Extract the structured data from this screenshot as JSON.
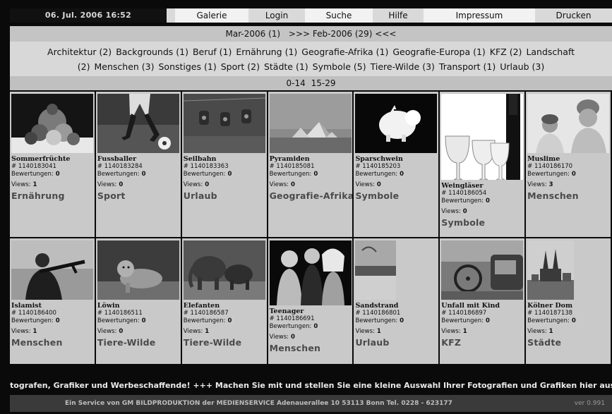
{
  "header": {
    "datetime": "06. Jul. 2006 16:52",
    "nav": [
      {
        "label": "Galerie"
      },
      {
        "label": "Login"
      },
      {
        "label": "Suche"
      },
      {
        "label": "Hilfe"
      },
      {
        "label": "Impressum"
      },
      {
        "label": "Drucken"
      }
    ]
  },
  "months": {
    "current": "Mar-2006 (1)",
    "next": ">>> Feb-2006 (29) <<<"
  },
  "categories": [
    "Architektur (2)",
    "Backgrounds (1)",
    "Beruf (1)",
    "Ernährung (1)",
    "Geografie-Afrika (1)",
    "Geografie-Europa (1)",
    "KFZ (2)",
    "Landschaft (2)",
    "Menschen (3)",
    "Sonstiges (1)",
    "Sport (2)",
    "Städte (1)",
    "Symbole (5)",
    "Tiere-Wilde (3)",
    "Transport (1)",
    "Urlaub (3)"
  ],
  "category_line1_suffix": "Landschaft",
  "category_line2_prefix": "(2)",
  "pages": [
    "0-14",
    "15-29"
  ],
  "labels": {
    "id_prefix": "# ",
    "ratings": "Bewertungen:",
    "views": "Views:"
  },
  "images": [
    {
      "title": "Sommerfrüchte",
      "id": "1140183041",
      "ratings": "0",
      "views": "1",
      "category": "Ernährung"
    },
    {
      "title": "Fussballer",
      "id": "1140183284",
      "ratings": "0",
      "views": "0",
      "category": "Sport"
    },
    {
      "title": "Seilbahn",
      "id": "1140183363",
      "ratings": "0",
      "views": "0",
      "category": "Urlaub"
    },
    {
      "title": "Pyramiden",
      "id": "1140185081",
      "ratings": "0",
      "views": "0",
      "category": "Geografie-Afrika"
    },
    {
      "title": "Sparschwein",
      "id": "1140185203",
      "ratings": "0",
      "views": "0",
      "category": "Symbole"
    },
    {
      "title": "Weingläser",
      "id": "1140186054",
      "ratings": "0",
      "views": "0",
      "category": "Symbole"
    },
    {
      "title": "Muslime",
      "id": "1140186170",
      "ratings": "0",
      "views": "3",
      "category": "Menschen"
    },
    {
      "title": "Islamist",
      "id": "1140186400",
      "ratings": "0",
      "views": "1",
      "category": "Menschen"
    },
    {
      "title": "Löwin",
      "id": "1140186511",
      "ratings": "0",
      "views": "0",
      "category": "Tiere-Wilde"
    },
    {
      "title": "Elefanten",
      "id": "1140186587",
      "ratings": "0",
      "views": "1",
      "category": "Tiere-Wilde"
    },
    {
      "title": "Teenager",
      "id": "1140186691",
      "ratings": "0",
      "views": "0",
      "category": "Menschen"
    },
    {
      "title": "Sandstrand",
      "id": "1140186801",
      "ratings": "0",
      "views": "1",
      "category": "Urlaub"
    },
    {
      "title": "Unfall mit Kind",
      "id": "1140186897",
      "ratings": "0",
      "views": "1",
      "category": "KFZ"
    },
    {
      "title": "Kölner Dom",
      "id": "1140187138",
      "ratings": "0",
      "views": "1",
      "category": "Städte"
    }
  ],
  "ticker": "tografen, Grafiker und Werbeschaffende! +++ Machen Sie mit und stellen Sie eine kleine Auswahl Ihrer Fotografien und Grafiken hier aus. +++",
  "footer": {
    "text": "Ein Service von GM BILDPRODUKTION   der MEDIENSERVICE   Adenauerallee 10   53113 Bonn   Tel. 0228 - 623177",
    "version": "ver 0.991"
  }
}
